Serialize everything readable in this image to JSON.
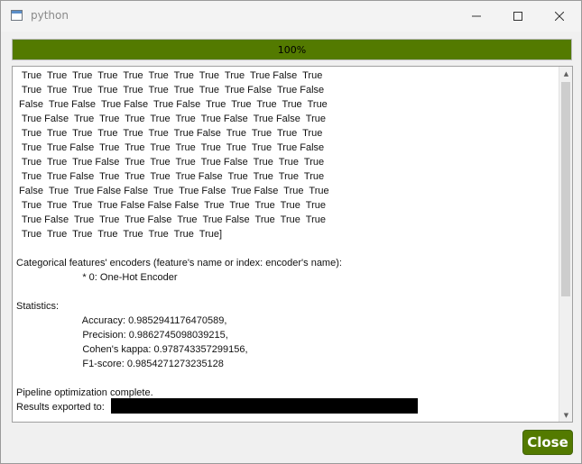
{
  "window": {
    "title": "python",
    "app_icon": "window-icon",
    "controls": {
      "minimize": "minimize-icon",
      "maximize": "maximize-icon",
      "close": "close-icon"
    }
  },
  "progress": {
    "value": 1.0,
    "label": "100%",
    "color": "#537a00"
  },
  "log": {
    "lines": [
      "  True  True  True  True  True  True  True  True  True  True False  True",
      "  True  True  True  True  True  True  True  True  True False  True False",
      " False  True False  True False  True False  True  True  True  True  True",
      "  True False  True  True  True  True  True  True False  True False  True",
      "  True  True  True  True  True  True  True False  True  True  True  True",
      "  True  True False  True  True  True  True  True  True  True  True False",
      "  True  True  True False  True  True  True  True False  True  True  True",
      "  True  True False  True  True  True  True False  True  True  True  True",
      " False  True  True False False  True  True False  True False  True  True",
      "  True  True  True  True False False False  True  True  True  True  True",
      "  True False  True  True  True False  True  True False  True  True  True",
      "  True  True  True  True  True  True  True  True]",
      "",
      "Categorical features' encoders (feature's name or index: encoder's name):",
      "                        * 0: One-Hot Encoder",
      "",
      "Statistics:",
      "                        Accuracy: 0.9852941176470589,",
      "                        Precision: 0.9862745098039215,",
      "                        Cohen's kappa: 0.978743357299156,",
      "                        F1-score: 0.9854271273235128",
      "",
      "Pipeline optimization complete.",
      "Results exported to: "
    ],
    "scroll": {
      "up": "scroll-up-arrow-icon",
      "down": "scroll-down-arrow-icon"
    }
  },
  "buttons": {
    "close_label": "Close",
    "accent": "#537a00"
  }
}
